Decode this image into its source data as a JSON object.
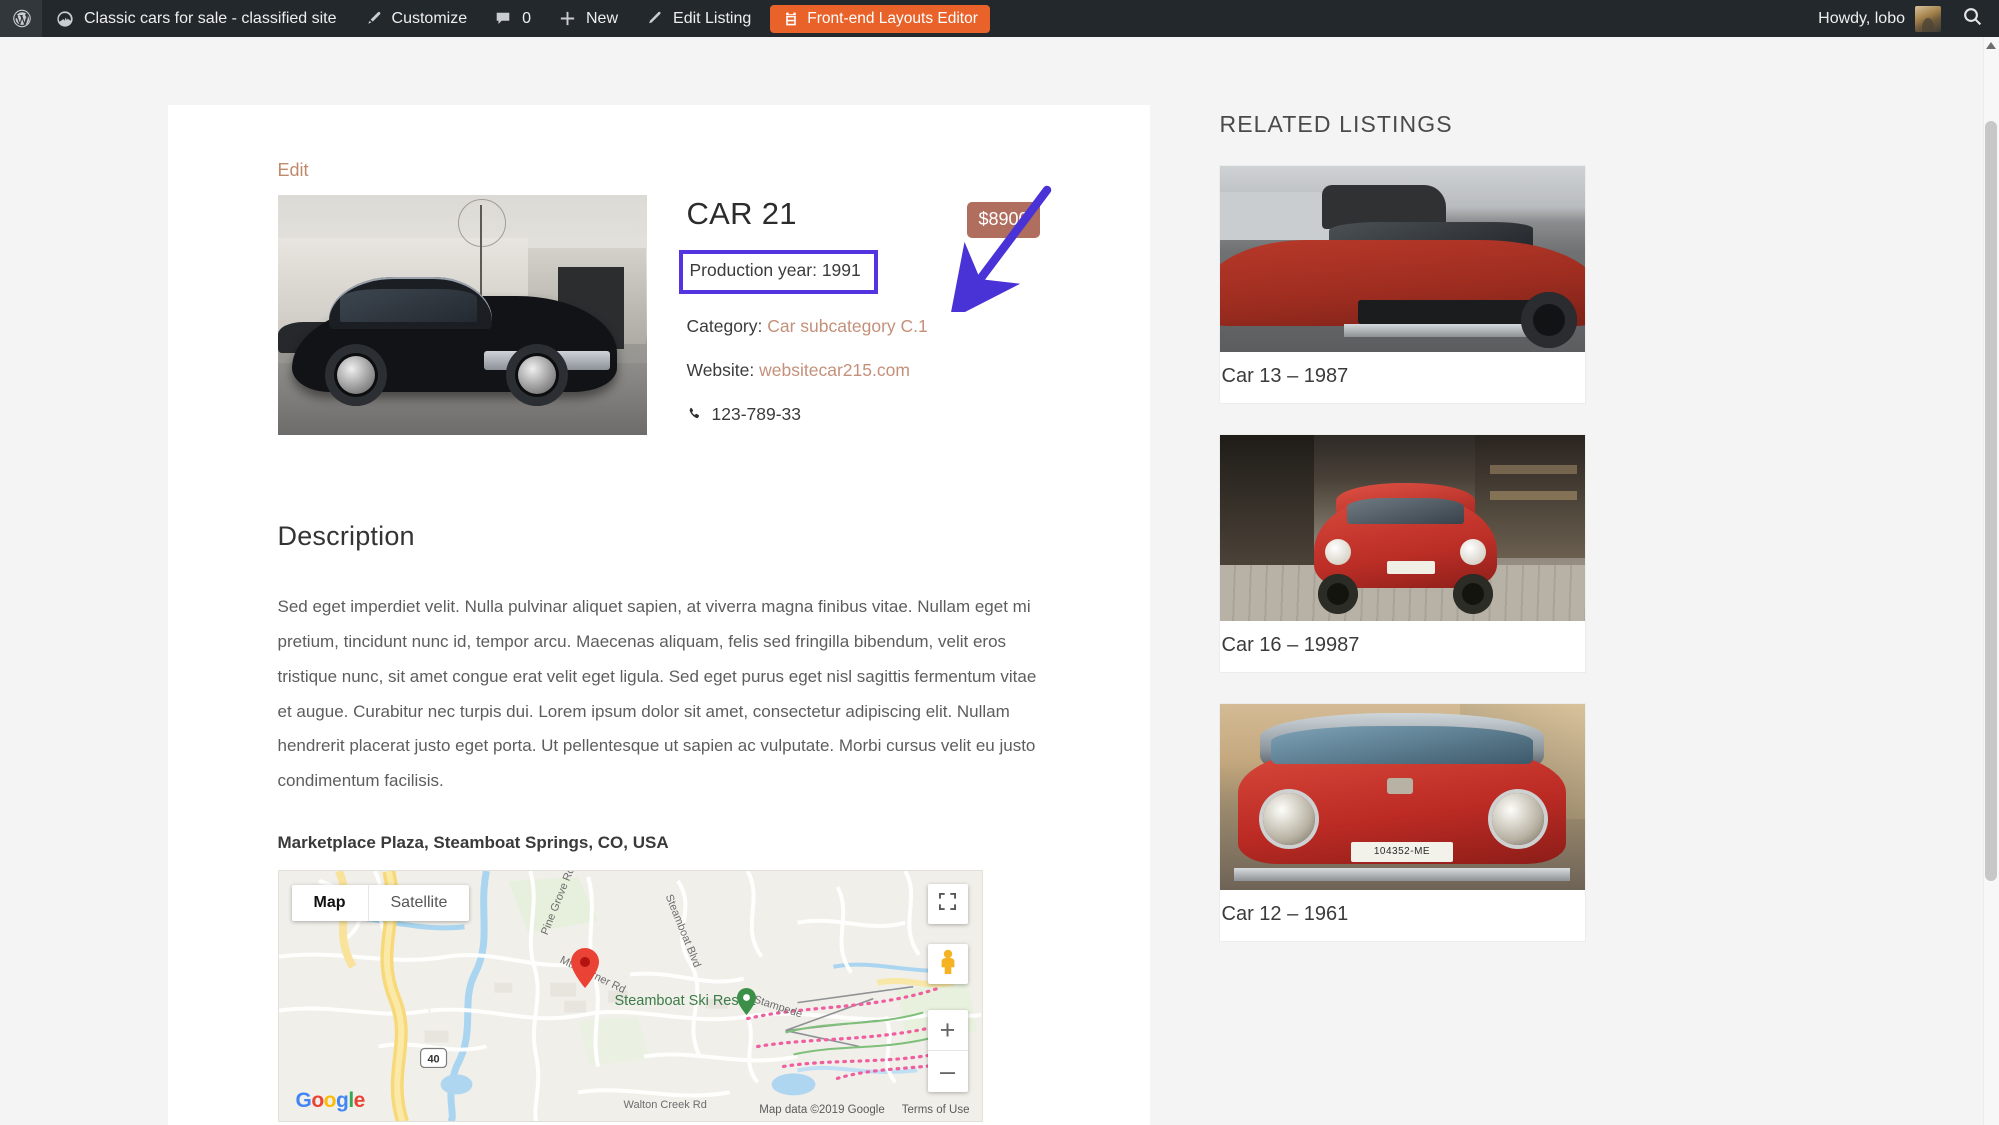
{
  "adminbar": {
    "wp_logo_icon": "wordpress-logo-icon",
    "site_icon": "dashboard-icon",
    "site_name": "Classic cars for sale - classified site",
    "customize_icon": "paintbrush-icon",
    "customize_label": "Customize",
    "comments_icon": "comment-bubble-icon",
    "comments_count": "0",
    "new_icon": "plus-icon",
    "new_label": "New",
    "edit_listing_icon": "pencil-icon",
    "edit_listing_label": "Edit Listing",
    "frontend_editor_icon": "layout-editor-icon",
    "frontend_editor_label": "Front-end Layouts Editor",
    "frontend_editor_color": "#e8622a",
    "howdy_label": "Howdy, lobo",
    "avatar_icon": "user-avatar",
    "search_icon": "search-icon"
  },
  "listing": {
    "edit_link": "Edit",
    "photo_icon": "listing-photo-black-coupe",
    "title": "CAR 21",
    "price": "$8900",
    "price_color": "#b06e5e",
    "production_year_label": "Production year:",
    "production_year_value": "1991",
    "category_label": "Category:",
    "category_value": "Car subcategory C.1",
    "website_label": "Website:",
    "website_value": "websitecar215.com",
    "phone_icon": "phone-handset-icon",
    "phone_value": "123-789-33",
    "link_color": "#c4907a",
    "highlight_color": "#5433e0"
  },
  "description": {
    "heading": "Description",
    "body": "Sed eget imperdiet velit. Nulla pulvinar aliquet sapien, at viverra magna finibus vitae. Nullam eget mi pretium, tincidunt nunc id, tempor arcu. Maecenas aliquam, felis sed fringilla bibendum, velit eros tristique nunc, sit amet congue erat velit eget ligula. Sed eget purus eget nisl sagittis fermentum vitae et augue. Curabitur nec turpis dui. Lorem ipsum dolor sit amet, consectetur adipiscing elit. Nullam hendrerit placerat justo eget porta. Ut pellentesque ut sapien ac vulputate. Morbi cursus velit eu justo condimentum facilisis.",
    "address": "Marketplace Plaza, Steamboat Springs, CO, USA"
  },
  "map": {
    "type_map_label": "Map",
    "type_satellite_label": "Satellite",
    "fullscreen_icon": "fullscreen-icon",
    "pegman_icon": "street-view-pegman-icon",
    "zoom_in_label": "+",
    "zoom_out_label": "–",
    "marker_icon": "map-marker-pin",
    "poi_icon": "map-poi-pin",
    "poi_label": "Steamboat Ski Resort",
    "road_labels": [
      "Pine Grove Rd",
      "Steamboat Blvd",
      "Mt. Werner Rd",
      "Stampede",
      "Walton Creek Rd",
      "40"
    ],
    "google_logo": "Google",
    "attribution": "Map data ©2019 Google",
    "terms_label": "Terms of Use"
  },
  "sidebar": {
    "heading": "RELATED LISTINGS",
    "items": [
      {
        "thumb_icon": "thumb-red-muscle-car",
        "caption": "Car 13 – 1987"
      },
      {
        "thumb_icon": "thumb-red-fiat-alley",
        "caption": "Car 16 – 19987"
      },
      {
        "thumb_icon": "thumb-red-fiat-front",
        "caption": "Car 12 – 1961",
        "plate": "104352-ME"
      }
    ]
  },
  "annotation": {
    "arrow_icon": "annotation-arrow",
    "arrow_color": "#4a33d6"
  },
  "scrollbar": {
    "up_arrow_icon": "chevron-up-icon"
  }
}
